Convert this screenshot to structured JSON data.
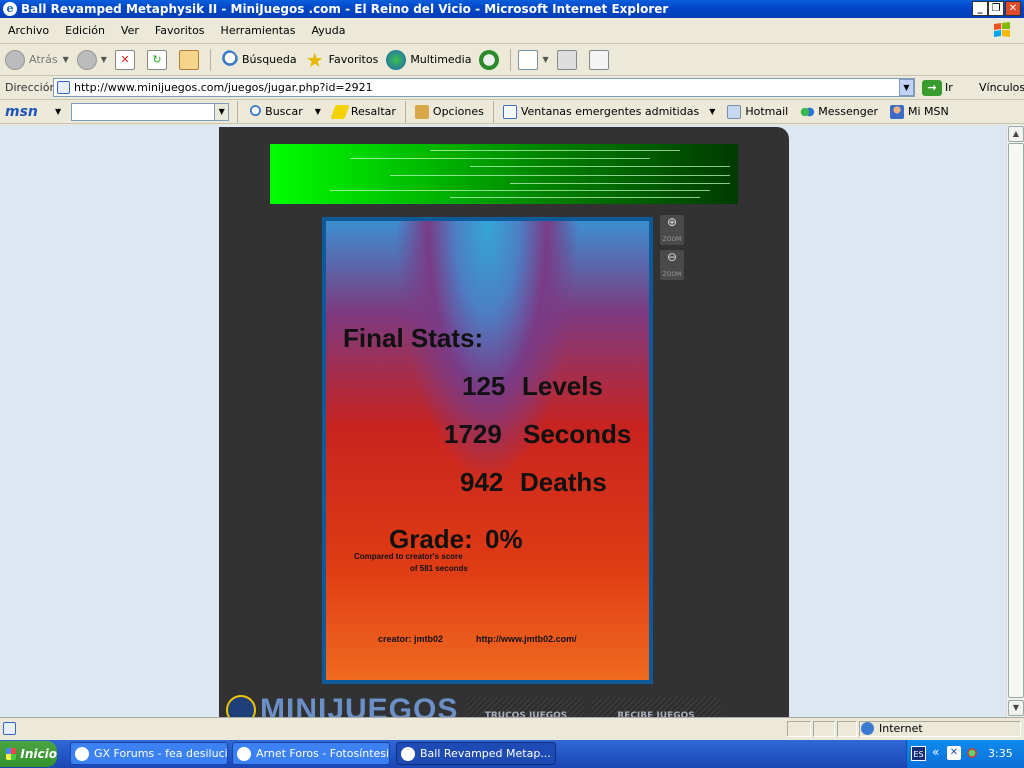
{
  "window": {
    "title": "Ball Revamped Metaphysik II - MiniJuegos .com - El Reino del Vicio - Microsoft Internet Explorer"
  },
  "menu": [
    "Archivo",
    "Edición",
    "Ver",
    "Favoritos",
    "Herramientas",
    "Ayuda"
  ],
  "toolbar": {
    "back": "Atrás",
    "search": "Búsqueda",
    "favorites": "Favoritos",
    "media": "Multimedia"
  },
  "address": {
    "label": "Dirección",
    "url": "http://www.minijuegos.com/juegos/jugar.php?id=2921",
    "go": "Ir",
    "links": "Vínculos"
  },
  "msn": {
    "logo": "msn",
    "search": "Buscar",
    "highlight": "Resaltar",
    "options": "Opciones",
    "popups": "Ventanas emergentes admitidas",
    "hotmail": "Hotmail",
    "messenger": "Messenger",
    "mymsn": "Mi MSN"
  },
  "game": {
    "heading": "Final Stats:",
    "levels_num": "125",
    "levels_label": "Levels",
    "seconds_num": "1729",
    "seconds_label": "Seconds",
    "deaths_num": "942",
    "deaths_label": "Deaths",
    "grade_label": "Grade:",
    "grade_value": "0%",
    "compare_line1": "Compared to creator's score",
    "compare_line2": "of 581 seconds",
    "creator": "creator: jmtb02",
    "creator_url": "http://www.jmtb02.com/",
    "zoom_label": "ZOOM"
  },
  "site": {
    "logo": "MINIJUEGOS",
    "tab1": "TRUCOS JUEGOS",
    "tab2": "RECIBE JUEGOS"
  },
  "status": {
    "zone": "Internet"
  },
  "taskbar": {
    "start": "Inicio",
    "tasks": [
      "GX Forums - fea desilucio...",
      "Arnet Foros - Fotosíntesi...",
      "Ball Revamped Metap..."
    ],
    "lang": "ES",
    "clock": "3:35"
  },
  "colors": {
    "title_bar": "#0247c8",
    "game_border": "#0d5a9a",
    "site_panel": "#323232",
    "page_bg": "#dde7f2"
  }
}
